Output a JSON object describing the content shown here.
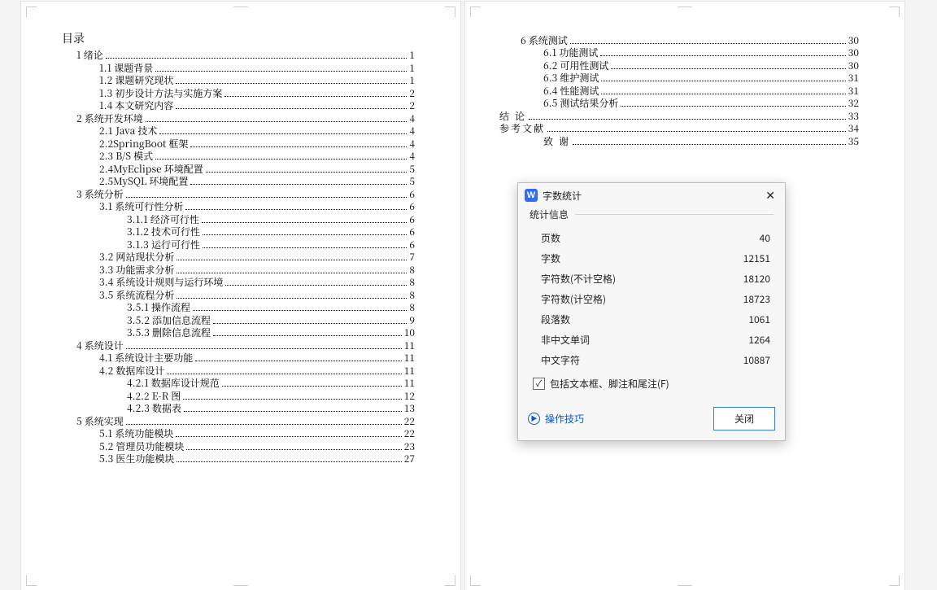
{
  "muLu": "目录",
  "toc_left": [
    {
      "level": 1,
      "text": "1 绪论",
      "page": "1"
    },
    {
      "level": 2,
      "text": "1.1 课题背景",
      "page": "1"
    },
    {
      "level": 2,
      "text": "1.2 课题研究现状",
      "page": "1"
    },
    {
      "level": 2,
      "text": "1.3 初步设计方法与实施方案",
      "page": "2"
    },
    {
      "level": 2,
      "text": "1.4 本文研究内容",
      "page": "2"
    },
    {
      "level": 1,
      "text": "2 系统开发环境",
      "page": "4"
    },
    {
      "level": 2,
      "text": "2.1 Java 技术",
      "page": "4"
    },
    {
      "level": 2,
      "text": "2.2SpringBoot 框架",
      "page": "4"
    },
    {
      "level": 2,
      "text": "2.3 B/S 模式",
      "page": "4"
    },
    {
      "level": 2,
      "text": "2.4MyEclipse 环境配置",
      "page": "5"
    },
    {
      "level": 2,
      "text": "2.5MySQL 环境配置",
      "page": "5"
    },
    {
      "level": 1,
      "text": "3 系统分析",
      "page": "6"
    },
    {
      "level": 2,
      "text": "3.1 系统可行性分析",
      "page": "6"
    },
    {
      "level": 3,
      "text": "3.1.1 经济可行性",
      "page": "6"
    },
    {
      "level": 3,
      "text": "3.1.2 技术可行性",
      "page": "6"
    },
    {
      "level": 3,
      "text": "3.1.3 运行可行性",
      "page": "6"
    },
    {
      "level": 2,
      "text": "3.2 网站现状分析",
      "page": "7"
    },
    {
      "level": 2,
      "text": "3.3 功能需求分析",
      "page": "8"
    },
    {
      "level": 2,
      "text": "3.4 系统设计规则与运行环境",
      "page": "8"
    },
    {
      "level": 2,
      "text": "3.5 系统流程分析",
      "page": "8"
    },
    {
      "level": 3,
      "text": "3.5.1 操作流程",
      "page": "8"
    },
    {
      "level": 3,
      "text": "3.5.2 添加信息流程",
      "page": "9"
    },
    {
      "level": 3,
      "text": "3.5.3 删除信息流程",
      "page": "10"
    },
    {
      "level": 1,
      "text": "4 系统设计",
      "page": "11"
    },
    {
      "level": 2,
      "text": "4.1 系统设计主要功能",
      "page": "11"
    },
    {
      "level": 2,
      "text": "4.2 数据库设计",
      "page": "11"
    },
    {
      "level": 3,
      "text": "4.2.1 数据库设计规范",
      "page": "11"
    },
    {
      "level": 3,
      "text": "4.2.2 E-R 图",
      "page": "12"
    },
    {
      "level": 3,
      "text": "4.2.3 数据表",
      "page": "13"
    },
    {
      "level": 1,
      "text": "5 系统实现",
      "page": "22"
    },
    {
      "level": 2,
      "text": "5.1   系统功能模块",
      "page": "22"
    },
    {
      "level": 2,
      "text": "5.2   管理员功能模块",
      "page": "23"
    },
    {
      "level": 2,
      "text": "5.3   医生功能模块",
      "page": "27"
    }
  ],
  "toc_right": [
    {
      "level": 1,
      "text": "6 系统测试",
      "page": "30"
    },
    {
      "level": 2,
      "text": "6.1 功能测试",
      "page": "30"
    },
    {
      "level": 2,
      "text": "6.2 可用性测试",
      "page": "30"
    },
    {
      "level": 2,
      "text": "6.3 维护测试",
      "page": "31"
    },
    {
      "level": 2,
      "text": "6.4 性能测试",
      "page": "31"
    },
    {
      "level": 2,
      "text": "6.5 测试结果分析",
      "page": "32"
    },
    {
      "level": 0,
      "text": "结 论",
      "page": "33",
      "section": true
    },
    {
      "level": 0,
      "text": "参考文献",
      "page": "34",
      "section": true
    },
    {
      "level": 2,
      "text": "致 谢",
      "page": "35",
      "section": true
    }
  ],
  "dialog": {
    "title": "字数统计",
    "sectionLabel": "统计信息",
    "stats": [
      {
        "k": "页数",
        "v": "40"
      },
      {
        "k": "字数",
        "v": "12151"
      },
      {
        "k": "字符数(不计空格)",
        "v": "18120"
      },
      {
        "k": "字符数(计空格)",
        "v": "18723"
      },
      {
        "k": "段落数",
        "v": "1061"
      },
      {
        "k": "非中文单词",
        "v": "1264"
      },
      {
        "k": "中文字符",
        "v": "10887"
      }
    ],
    "checkboxLabel": "包括文本框、脚注和尾注(F)",
    "tips": "操作技巧",
    "close": "关闭",
    "appIcon": "W"
  }
}
